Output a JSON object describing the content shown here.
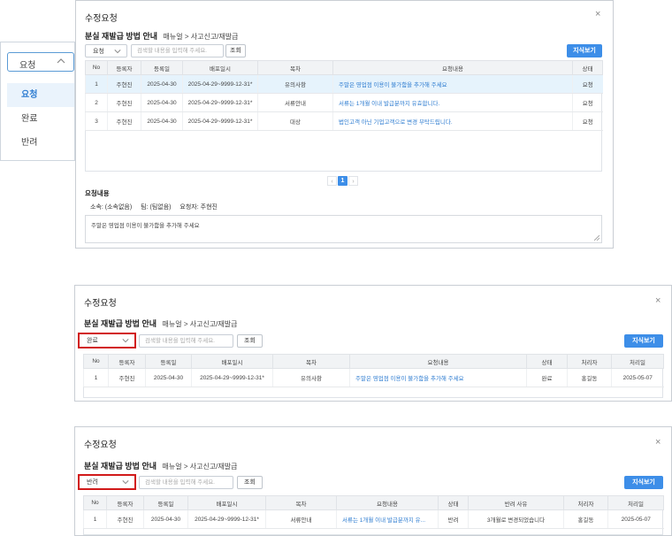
{
  "dropdown": {
    "selected": "요청",
    "options": [
      "요청",
      "완료",
      "반려"
    ]
  },
  "panel1": {
    "title": "수정요청",
    "guide_title": "분실 재발급 방법 안내",
    "guide_path": "매뉴얼 > 사고신고/재발급",
    "filter_value": "요청",
    "search_placeholder": "검색할 내용을 입력해 주세요.",
    "query_label": "조회",
    "guide_button": "지식보기",
    "columns": [
      "No",
      "등록자",
      "등록일",
      "배포일시",
      "목차",
      "요청내용",
      "상태"
    ],
    "rows": [
      [
        "1",
        "주현진",
        "2025-04-30",
        "2025-04-29~9999-12-31*",
        "유의사항",
        "주말은 영업점 이용이 불가함을 추가해 주세요",
        "요청"
      ],
      [
        "2",
        "주현진",
        "2025-04-30",
        "2025-04-29~9999-12-31*",
        "서류안내",
        "서류는 1개월 이내 발급분까지 유효합니다.",
        "요청"
      ],
      [
        "3",
        "주현진",
        "2025-04-30",
        "2025-04-29~9999-12-31*",
        "대상",
        "법인고객 아닌 기업고객으로 변경 부탁드립니다.",
        "요청"
      ]
    ],
    "page": "1",
    "request_heading": "요청내용",
    "affiliation": "소속: (소속없음)",
    "team": "팀: (팀없음)",
    "requester": "요청자: 주현진",
    "request_text": "주말은 영업점 이용이 불가함을 추가해 주세요"
  },
  "panel2": {
    "title": "수정요청",
    "guide_title": "분실 재발급 방법 안내",
    "guide_path": "매뉴얼 > 사고신고/재발급",
    "filter_value": "완료",
    "search_placeholder": "검색할 내용을 입력해 주세요.",
    "query_label": "조회",
    "guide_button": "지식보기",
    "columns": [
      "No",
      "등록자",
      "등록일",
      "배포일시",
      "목차",
      "요청내용",
      "상태",
      "처리자",
      "처리일"
    ],
    "rows": [
      [
        "1",
        "주현진",
        "2025-04-30",
        "2025-04-29~9999-12-31*",
        "유의사항",
        "주말은 영업점 이용이 불가함을 추가해 주세요",
        "완료",
        "홍길동",
        "2025-05-07"
      ]
    ]
  },
  "panel3": {
    "title": "수정요청",
    "guide_title": "분실 재발급 방법 안내",
    "guide_path": "매뉴얼 > 사고신고/재발급",
    "filter_value": "반려",
    "search_placeholder": "검색할 내용을 입력해 주세요.",
    "query_label": "조회",
    "guide_button": "지식보기",
    "columns": [
      "No",
      "등록자",
      "등록일",
      "배포일시",
      "목차",
      "요청내용",
      "상태",
      "반려 사유",
      "처리자",
      "처리일"
    ],
    "rows": [
      [
        "1",
        "주현진",
        "2025-04-30",
        "2025-04-29~9999-12-31*",
        "서류안내",
        "서류는 1개월 이내 발급분까지 유...",
        "반려",
        "3개월로 변경되었습니다",
        "홍길동",
        "2025-05-07"
      ]
    ]
  },
  "close_glyph": "×",
  "colors": {
    "accent": "#3d8ee8",
    "highlight_border": "#d11a1a",
    "link": "#2f7dd1"
  }
}
